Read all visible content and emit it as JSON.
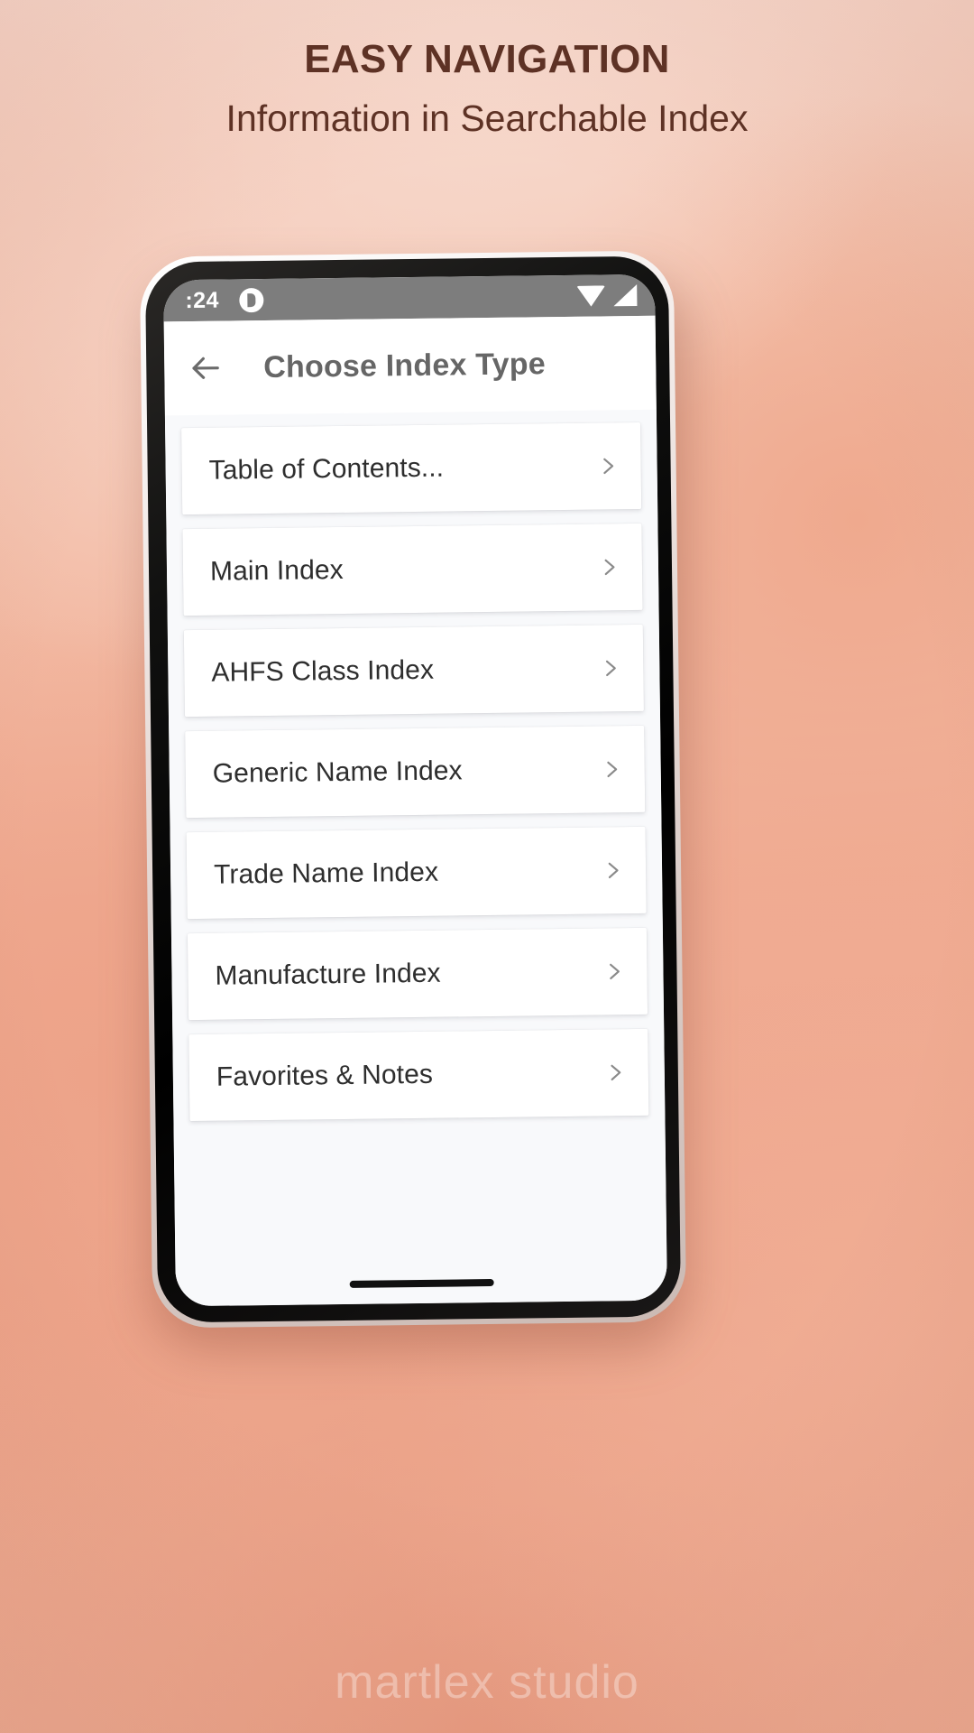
{
  "promo": {
    "headline": "EASY NAVIGATION",
    "subheadline": "Information in Searchable Index",
    "headline_color": "#5e3225",
    "background_accent": "#f0ab92",
    "watermark": "martlex studio"
  },
  "statusbar": {
    "time": ":24",
    "notification_icon": "notification-dot-icon",
    "wifi_icon": "wifi-icon",
    "signal_icon": "cell-signal-icon",
    "background_color": "#7d7d7d"
  },
  "appbar": {
    "back_icon": "back-arrow-icon",
    "title": "Choose Index Type",
    "title_color": "#666666"
  },
  "list": {
    "chevron_icon": "chevron-right-icon",
    "items": [
      {
        "label": "Table of Contents..."
      },
      {
        "label": "Main Index"
      },
      {
        "label": "AHFS Class Index"
      },
      {
        "label": "Generic Name Index"
      },
      {
        "label": "Trade Name Index"
      },
      {
        "label": "Manufacture Index"
      },
      {
        "label": "Favorites & Notes"
      }
    ]
  }
}
